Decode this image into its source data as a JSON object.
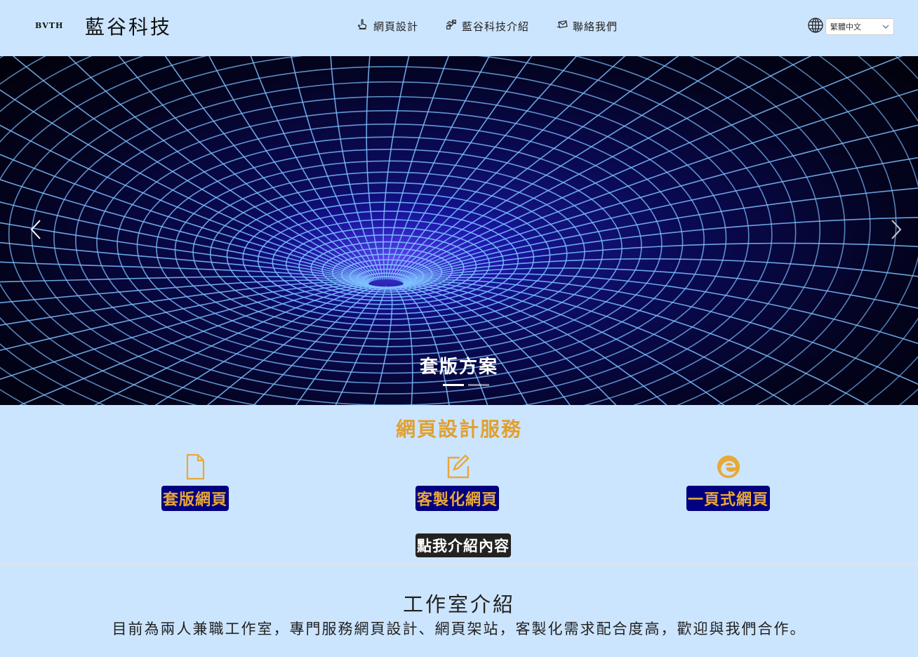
{
  "header": {
    "logo_mark": "BVTH",
    "brand": "藍谷科技",
    "nav": [
      {
        "label": "網頁設計",
        "icon": "hand-pointer-icon"
      },
      {
        "label": "藍谷科技介紹",
        "icon": "handshake-icon"
      },
      {
        "label": "聯絡我們",
        "icon": "envelope-hand-icon"
      }
    ],
    "language": {
      "icon": "globe-icon",
      "selected": "繁體中文"
    }
  },
  "carousel": {
    "caption": "套版方案",
    "indicators": 2,
    "active_index": 0,
    "colors": {
      "grid": "#6fb4ff",
      "bg": "#03031e"
    }
  },
  "services": {
    "title": "網頁設計服務",
    "items": [
      {
        "label": "套版網頁",
        "icon": "file-icon"
      },
      {
        "label": "客製化網頁",
        "icon": "edit-icon"
      },
      {
        "label": "一頁式網頁",
        "icon": "edge-browser-icon"
      }
    ],
    "more_button": "點我介紹內容",
    "colors": {
      "title": "#e0a030",
      "button_bg": "#000080",
      "button_text": "#e8a838"
    }
  },
  "about": {
    "title": "工作室介紹",
    "text": "目前為兩人兼職工作室，專門服務網頁設計、網頁架站，客製化需求配合度高，歡迎與我們合作。"
  }
}
